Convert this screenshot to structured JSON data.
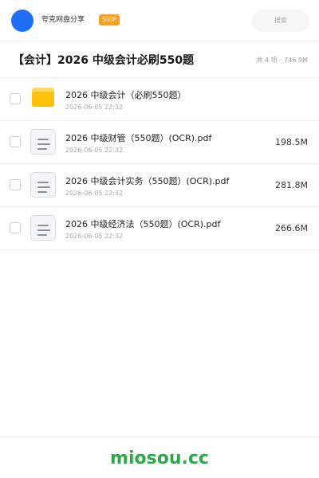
{
  "header": {
    "site_name": "夸克网盘分享",
    "badge": "SVIP",
    "search_placeholder": "搜索"
  },
  "folder": {
    "title": "【会计】2026 中级会计必刷550题",
    "count": "共 4 项",
    "separator": "·",
    "total_size": "746.9M"
  },
  "files": [
    {
      "name": "2026 中级会计（必刷550题）",
      "date": "2026-06-05 22:32",
      "size": "",
      "type": "folder"
    },
    {
      "name": "2026 中级财管（550题）(OCR).pdf",
      "date": "2026-06-05 22:32",
      "size": "198.5M",
      "type": "pdf"
    },
    {
      "name": "2026 中级会计实务（550题）(OCR).pdf",
      "date": "2026-06-05 22:32",
      "size": "281.8M",
      "type": "pdf"
    },
    {
      "name": "2026 中级经济法（550题）(OCR).pdf",
      "date": "2026-06-05 22:32",
      "size": "266.6M",
      "type": "pdf"
    }
  ],
  "footer": {
    "brand": "miosou.cc"
  },
  "colors": {
    "accent": "#1e6ff5",
    "badge": "#f7a021",
    "folder": "#fdc20c",
    "brand": "#2fa84c"
  }
}
